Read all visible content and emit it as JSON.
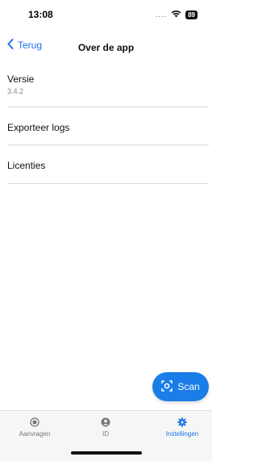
{
  "status_bar": {
    "time": "13:08",
    "signal": "....",
    "battery": "89"
  },
  "nav": {
    "back_label": "Terug",
    "title": "Over de app"
  },
  "list": {
    "version_label": "Versie",
    "version_value": "3.4.2",
    "export_logs_label": "Exporteer logs",
    "licenses_label": "Licenties"
  },
  "fab": {
    "label": "Scan",
    "icon": "scan-icon"
  },
  "tabs": [
    {
      "label": "Aanvragen",
      "icon": "requests-icon",
      "active": false
    },
    {
      "label": "ID",
      "icon": "person-icon",
      "active": false
    },
    {
      "label": "Instellingen",
      "icon": "gear-icon",
      "active": true
    }
  ],
  "colors": {
    "accent": "#1a73e8",
    "fab": "#1a7de8",
    "divider": "#d8d8d8"
  }
}
